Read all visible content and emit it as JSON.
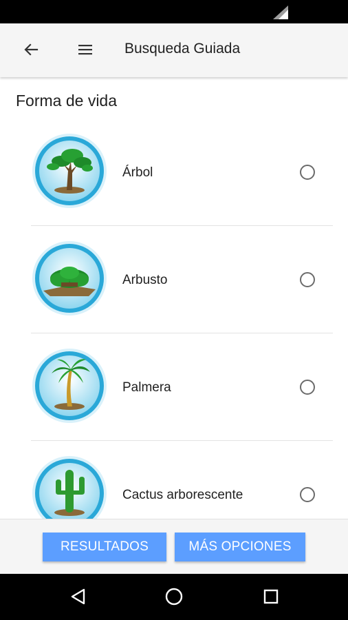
{
  "app_bar": {
    "title": "Busqueda Guiada",
    "back_icon": "arrow-back-icon",
    "menu_icon": "hamburger-menu-icon"
  },
  "section": {
    "title": "Forma de vida"
  },
  "options": [
    {
      "label": "Árbol",
      "icon": "tree-icon",
      "selected": false
    },
    {
      "label": "Arbusto",
      "icon": "shrub-icon",
      "selected": false
    },
    {
      "label": "Palmera",
      "icon": "palm-tree-icon",
      "selected": false
    },
    {
      "label": "Cactus arborescente",
      "icon": "cactus-icon",
      "selected": false
    }
  ],
  "buttons": {
    "results_label": "RESULTADOS",
    "more_label": "MÁS OPCIONES"
  },
  "colors": {
    "accent": "#5c9eff",
    "badge_ring": "#29a9d6",
    "app_bar_bg": "#f5f5f5"
  },
  "system_nav": {
    "back": "nav-back-icon",
    "home": "nav-home-icon",
    "recents": "nav-recents-icon"
  }
}
